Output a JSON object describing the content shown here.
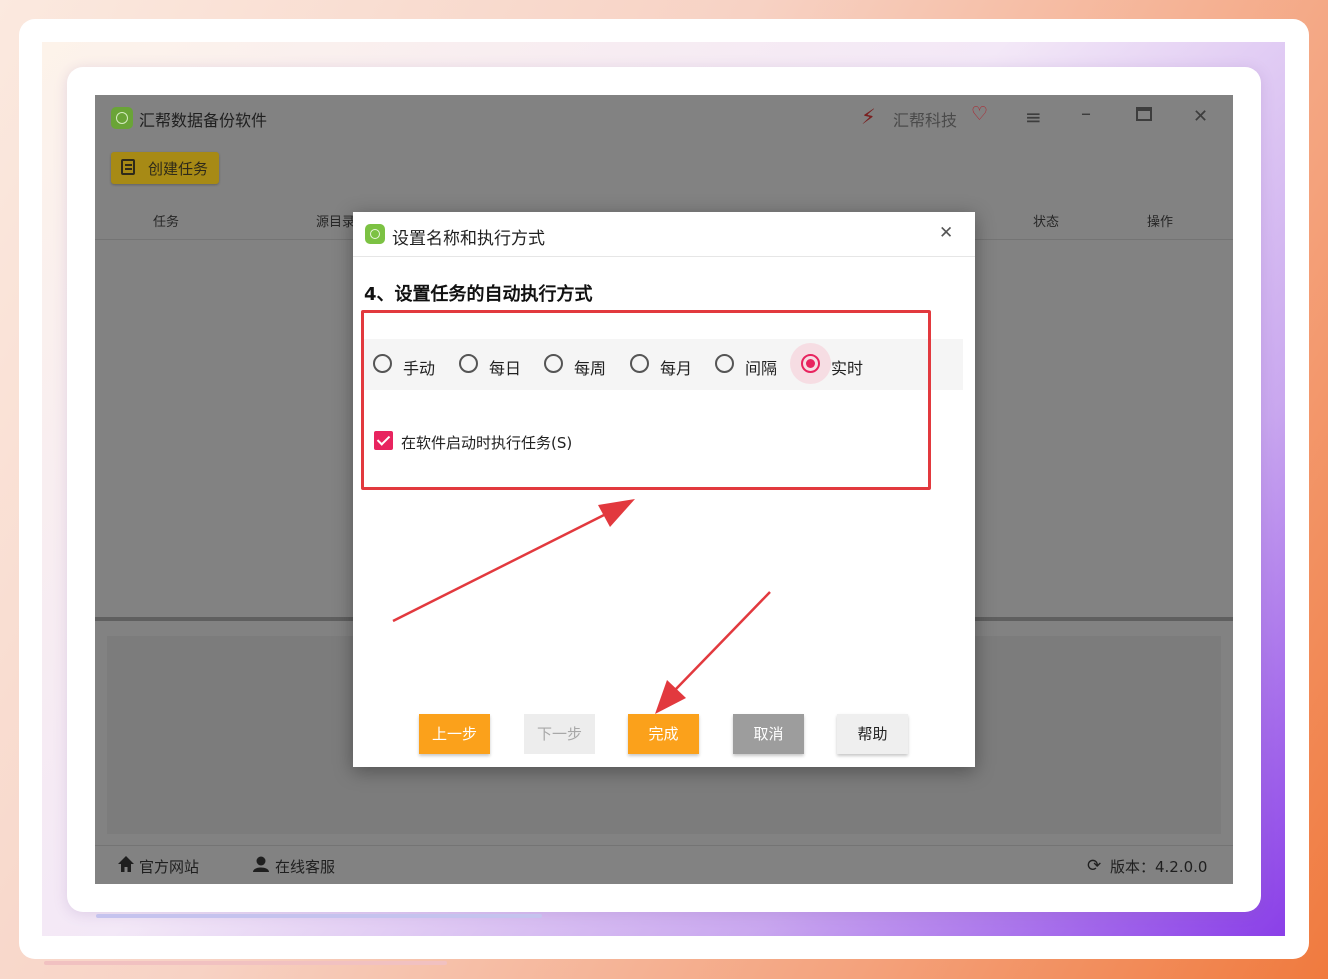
{
  "app": {
    "title": "汇帮数据备份软件",
    "brand": "汇帮科技",
    "create_task_label": "创建任务",
    "columns": [
      "任务",
      "源目录",
      "状态",
      "操作"
    ],
    "footer": {
      "website": "官方网站",
      "support": "在线客服",
      "version": "版本：4.2.0.0"
    }
  },
  "dialog": {
    "title": "设置名称和执行方式",
    "heading": "4、设置任务的自动执行方式",
    "modes": [
      "手动",
      "每日",
      "每周",
      "每月",
      "间隔",
      "实时"
    ],
    "selected_mode": "实时",
    "startup_checkbox": {
      "label": "在软件启动时执行任务(S)",
      "checked": true
    },
    "buttons": {
      "prev": "上一步",
      "next": "下一步",
      "finish": "完成",
      "cancel": "取消",
      "help": "帮助"
    }
  },
  "colors": {
    "accent_orange": "#fba11b",
    "accent_pink": "#e8245f",
    "annotation_red": "#e2393e"
  }
}
